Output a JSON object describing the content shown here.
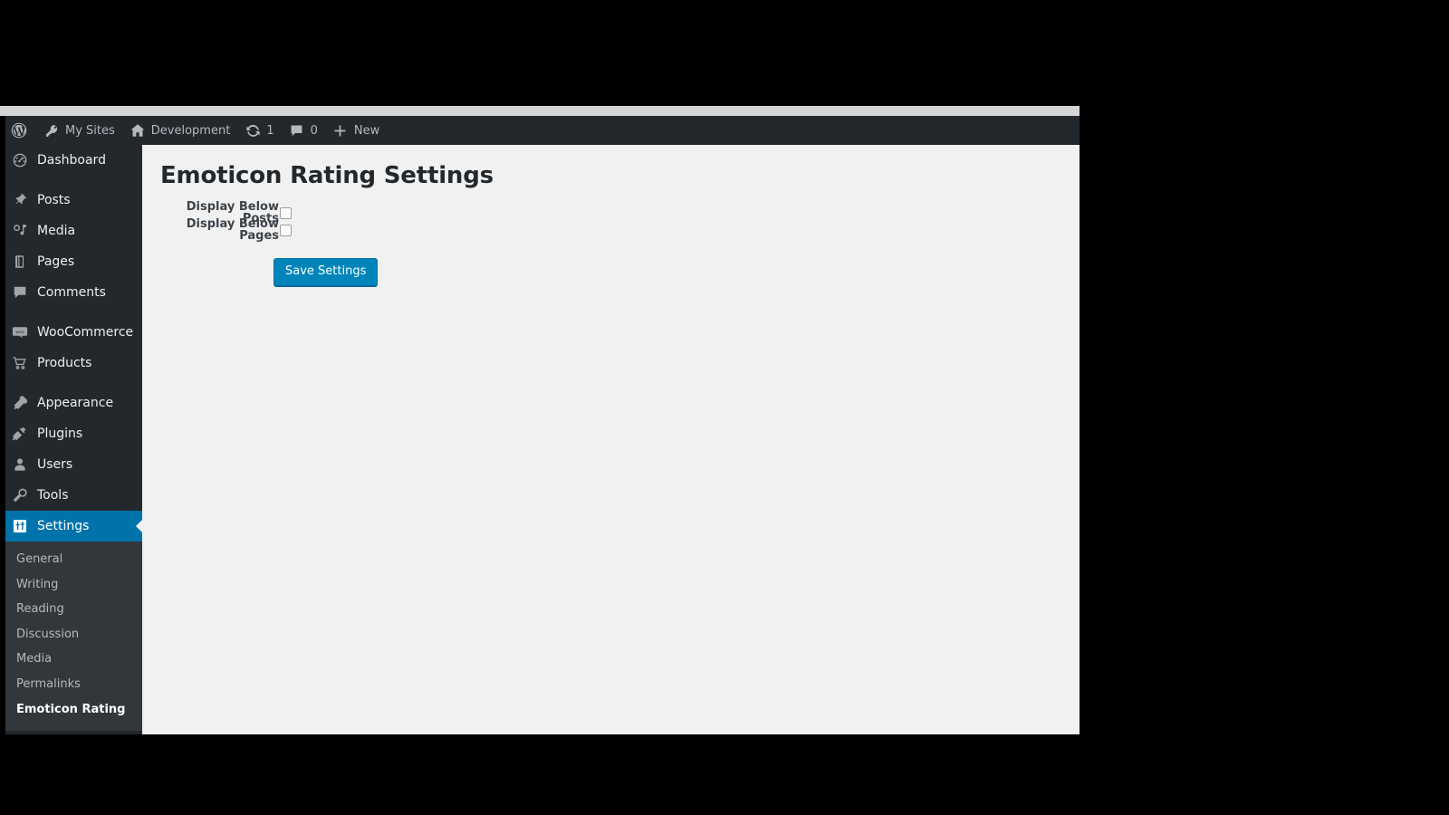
{
  "adminbar": {
    "items": [
      {
        "name": "wordpress-logo",
        "icon": "wordpress-logo-icon",
        "label": ""
      },
      {
        "name": "my-sites",
        "icon": "key-icon",
        "label": "My Sites"
      },
      {
        "name": "site-name",
        "icon": "home-icon",
        "label": "Development"
      },
      {
        "name": "updates",
        "icon": "updates-icon",
        "label": "1"
      },
      {
        "name": "comments",
        "icon": "comment-bubble-icon",
        "label": "0"
      },
      {
        "name": "new-content",
        "icon": "plus-icon",
        "label": "New"
      }
    ]
  },
  "sidebar": {
    "items": [
      {
        "label": "Dashboard",
        "icon": "dashboard-icon",
        "current": false,
        "separator_after": true
      },
      {
        "label": "Posts",
        "icon": "pin-icon",
        "current": false,
        "separator_after": false
      },
      {
        "label": "Media",
        "icon": "media-icon",
        "current": false,
        "separator_after": false
      },
      {
        "label": "Pages",
        "icon": "pages-icon",
        "current": false,
        "separator_after": false
      },
      {
        "label": "Comments",
        "icon": "comment-bubble-icon",
        "current": false,
        "separator_after": true
      },
      {
        "label": "WooCommerce",
        "icon": "woocommerce-icon",
        "current": false,
        "separator_after": false
      },
      {
        "label": "Products",
        "icon": "cart-icon",
        "current": false,
        "separator_after": true
      },
      {
        "label": "Appearance",
        "icon": "appearance-brush-icon",
        "current": false,
        "separator_after": false
      },
      {
        "label": "Plugins",
        "icon": "plugins-plug-icon",
        "current": false,
        "separator_after": false
      },
      {
        "label": "Users",
        "icon": "users-icon",
        "current": false,
        "separator_after": false
      },
      {
        "label": "Tools",
        "icon": "tools-wrench-icon",
        "current": false,
        "separator_after": false
      },
      {
        "label": "Settings",
        "icon": "settings-sliders-icon",
        "current": true,
        "separator_after": false
      }
    ],
    "submenu": [
      {
        "label": "General",
        "current": false
      },
      {
        "label": "Writing",
        "current": false
      },
      {
        "label": "Reading",
        "current": false
      },
      {
        "label": "Discussion",
        "current": false
      },
      {
        "label": "Media",
        "current": false
      },
      {
        "label": "Permalinks",
        "current": false
      },
      {
        "label": "Emoticon Rating",
        "current": true
      }
    ]
  },
  "main": {
    "title": "Emoticon Rating Settings",
    "fields": [
      {
        "label": "Display Below Posts",
        "checked": false,
        "name": "display-below-posts"
      },
      {
        "label": "Display Below Pages",
        "checked": false,
        "name": "display-below-pages"
      }
    ],
    "save_label": "Save Settings"
  },
  "colors": {
    "sidebar_bg": "#23282d",
    "submenu_bg": "#32373c",
    "accent_blue": "#0073aa",
    "button_blue": "#0085ba",
    "content_bg": "#f1f1f1"
  }
}
